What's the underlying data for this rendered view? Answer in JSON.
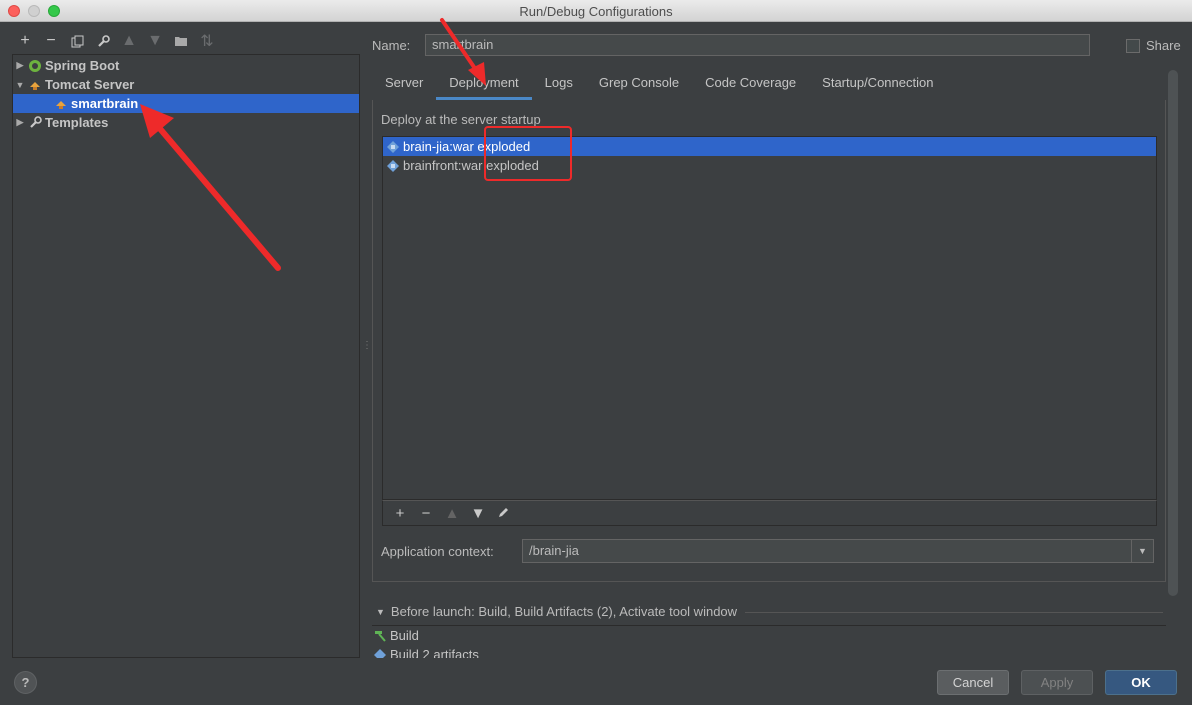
{
  "window": {
    "title": "Run/Debug Configurations"
  },
  "left_toolbar": {
    "icons": [
      "plus-icon",
      "minus-icon",
      "copy-icon",
      "wrench-icon",
      "arrow-up-icon",
      "arrow-down-icon",
      "folder-icon",
      "sort-icon"
    ]
  },
  "tree": {
    "items": [
      {
        "label": "Spring Boot",
        "icon": "spring-boot-icon",
        "expanded": false
      },
      {
        "label": "Tomcat Server",
        "icon": "tomcat-icon",
        "expanded": true
      },
      {
        "label": "smartbrain",
        "icon": "tomcat-icon",
        "selected": true
      },
      {
        "label": "Templates",
        "icon": "wrench-icon",
        "expanded": false
      }
    ]
  },
  "config": {
    "name_label": "Name:",
    "name_value": "smartbrain",
    "share_label": "Share"
  },
  "tabs": [
    "Server",
    "Deployment",
    "Logs",
    "Grep Console",
    "Code Coverage",
    "Startup/Connection"
  ],
  "active_tab": "Deployment",
  "deployment": {
    "section_label": "Deploy at the server startup",
    "artifacts": [
      "brain-jia:war exploded",
      "brainfront:war exploded"
    ],
    "selected_artifact": "brain-jia:war exploded",
    "toolbar_icons": [
      "plus-icon",
      "minus-icon",
      "arrow-up-icon",
      "arrow-down-icon",
      "edit-icon"
    ],
    "context_label": "Application context:",
    "context_value": "/brain-jia"
  },
  "before_launch": {
    "label": "Before launch: Build, Build Artifacts (2), Activate tool window",
    "items": [
      "Build",
      "Build 2 artifacts"
    ]
  },
  "buttons": {
    "help": "?",
    "cancel": "Cancel",
    "apply": "Apply",
    "ok": "OK"
  },
  "colors": {
    "background": "#3c3f41",
    "selection": "#2f65ca",
    "annotation": "#ee2a2a",
    "ok_button": "#365880"
  }
}
